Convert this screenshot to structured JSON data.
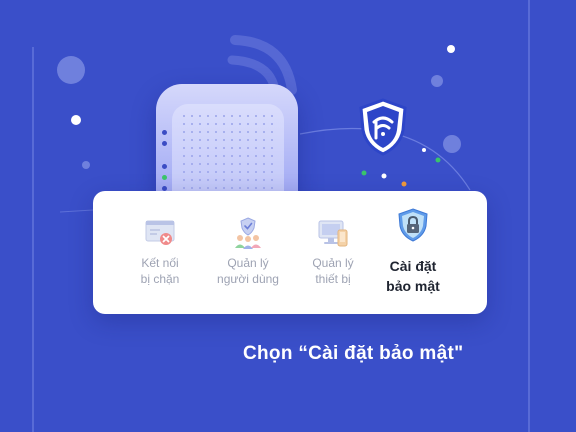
{
  "menu": {
    "items": [
      {
        "label": "Kết nối\nbị chặn",
        "icon": "blocked-connection-icon",
        "active": false
      },
      {
        "label": "Quản lý\nngười dùng",
        "icon": "user-management-icon",
        "active": false
      },
      {
        "label": "Quản lý\nthiết bị",
        "icon": "device-management-icon",
        "active": false
      },
      {
        "label": "Cài đặt\nbảo mật",
        "icon": "security-settings-icon",
        "active": true
      }
    ]
  },
  "caption": "Chọn “Cài đặt bảo mật\"",
  "colors": {
    "background": "#3a4fc9",
    "card": "#ffffff",
    "muted_label": "#9ea3b3",
    "active_label": "#1f2430",
    "shield_blue": "#2d45c8"
  }
}
